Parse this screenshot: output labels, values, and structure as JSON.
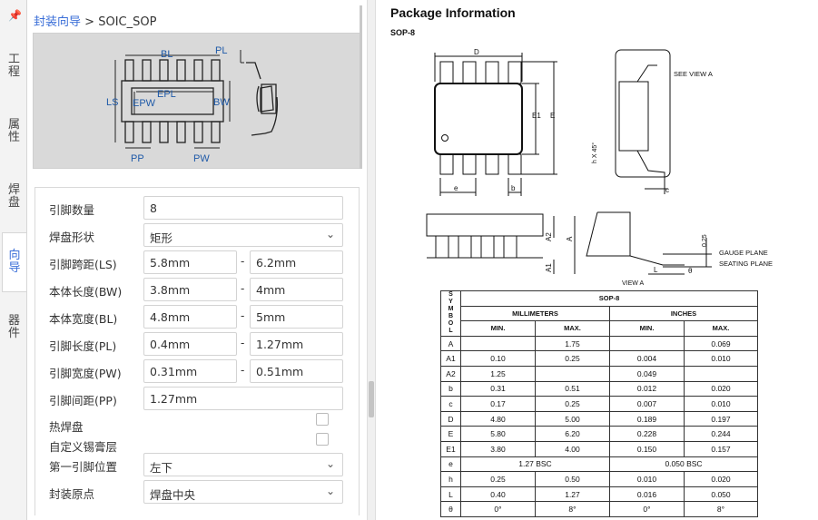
{
  "vtabs": {
    "pin_icon": "pin-icon",
    "items": [
      {
        "label": "工程"
      },
      {
        "label": "属性"
      },
      {
        "label": "焊盘"
      },
      {
        "label": "向导"
      },
      {
        "label": "器件"
      }
    ]
  },
  "breadcrumb": {
    "link": "封装向导",
    "sep": ">",
    "current": "SOIC_SOP"
  },
  "preview": {
    "labels": {
      "BL": "BL",
      "PL": "PL",
      "LS": "LS",
      "EPL": "EPL",
      "EPW": "EPW",
      "BW": "BW",
      "PP": "PP",
      "PW": "PW"
    }
  },
  "form": {
    "pin_count": {
      "label": "引脚数量",
      "value": "8"
    },
    "pad_shape": {
      "label": "焊盘形状",
      "value": "矩形"
    },
    "ls": {
      "label": "引脚跨距(LS)",
      "min": "5.8mm",
      "max": "6.2mm"
    },
    "bw": {
      "label": "本体长度(BW)",
      "min": "3.8mm",
      "max": "4mm"
    },
    "bl": {
      "label": "本体宽度(BL)",
      "min": "4.8mm",
      "max": "5mm"
    },
    "pl": {
      "label": "引脚长度(PL)",
      "min": "0.4mm",
      "max": "1.27mm"
    },
    "pw": {
      "label": "引脚宽度(PW)",
      "min": "0.31mm",
      "max": "0.51mm"
    },
    "pp": {
      "label": "引脚间距(PP)",
      "value": "1.27mm"
    },
    "thermal": {
      "label": "热焊盘"
    },
    "paste": {
      "label": "自定义锡膏层"
    },
    "pin1": {
      "label": "第一引脚位置",
      "value": "左下"
    },
    "origin": {
      "label": "封装原点",
      "value": "焊盘中央"
    },
    "dash": "-"
  },
  "doc": {
    "title": "Package Information",
    "subtitle": "SOP-8",
    "drawing_labels": {
      "D": "D",
      "E1": "E1",
      "E": "E",
      "e": "e",
      "b": "b",
      "c": "c",
      "A": "A",
      "A1": "A1",
      "A2": "A2",
      "L": "L",
      "h45": "h X 45°",
      "see_view_a": "SEE VIEW A",
      "view_a": "VIEW A",
      "gauge": "GAUGE PLANE",
      "seating": "SEATING PLANE",
      "gauge_val": "0.25",
      "theta": "θ"
    },
    "table": {
      "header": "SOP-8",
      "symbol_letters": [
        "S",
        "Y",
        "M",
        "B",
        "O",
        "L"
      ],
      "groups": [
        "MILLIMETERS",
        "INCHES"
      ],
      "sub": [
        "MIN.",
        "MAX.",
        "MIN.",
        "MAX."
      ],
      "rows": [
        {
          "sym": "A",
          "mm_min": "",
          "mm_max": "1.75",
          "in_min": "",
          "in_max": "0.069"
        },
        {
          "sym": "A1",
          "mm_min": "0.10",
          "mm_max": "0.25",
          "in_min": "0.004",
          "in_max": "0.010"
        },
        {
          "sym": "A2",
          "mm_min": "1.25",
          "mm_max": "",
          "in_min": "0.049",
          "in_max": ""
        },
        {
          "sym": "b",
          "mm_min": "0.31",
          "mm_max": "0.51",
          "in_min": "0.012",
          "in_max": "0.020"
        },
        {
          "sym": "c",
          "mm_min": "0.17",
          "mm_max": "0.25",
          "in_min": "0.007",
          "in_max": "0.010"
        },
        {
          "sym": "D",
          "mm_min": "4.80",
          "mm_max": "5.00",
          "in_min": "0.189",
          "in_max": "0.197"
        },
        {
          "sym": "E",
          "mm_min": "5.80",
          "mm_max": "6.20",
          "in_min": "0.228",
          "in_max": "0.244"
        },
        {
          "sym": "E1",
          "mm_min": "3.80",
          "mm_max": "4.00",
          "in_min": "0.150",
          "in_max": "0.157"
        },
        {
          "sym": "e",
          "mm_span": "1.27 BSC",
          "in_span": "0.050 BSC"
        },
        {
          "sym": "h",
          "mm_min": "0.25",
          "mm_max": "0.50",
          "in_min": "0.010",
          "in_max": "0.020"
        },
        {
          "sym": "L",
          "mm_min": "0.40",
          "mm_max": "1.27",
          "in_min": "0.016",
          "in_max": "0.050"
        },
        {
          "sym": "θ",
          "mm_min": "0°",
          "mm_max": "8°",
          "in_min": "0°",
          "in_max": "8°"
        }
      ]
    }
  },
  "colors": {
    "accent": "#3b6fd8",
    "preview_bg": "#d9d9d9",
    "dim_blue": "#1f5aa8"
  }
}
